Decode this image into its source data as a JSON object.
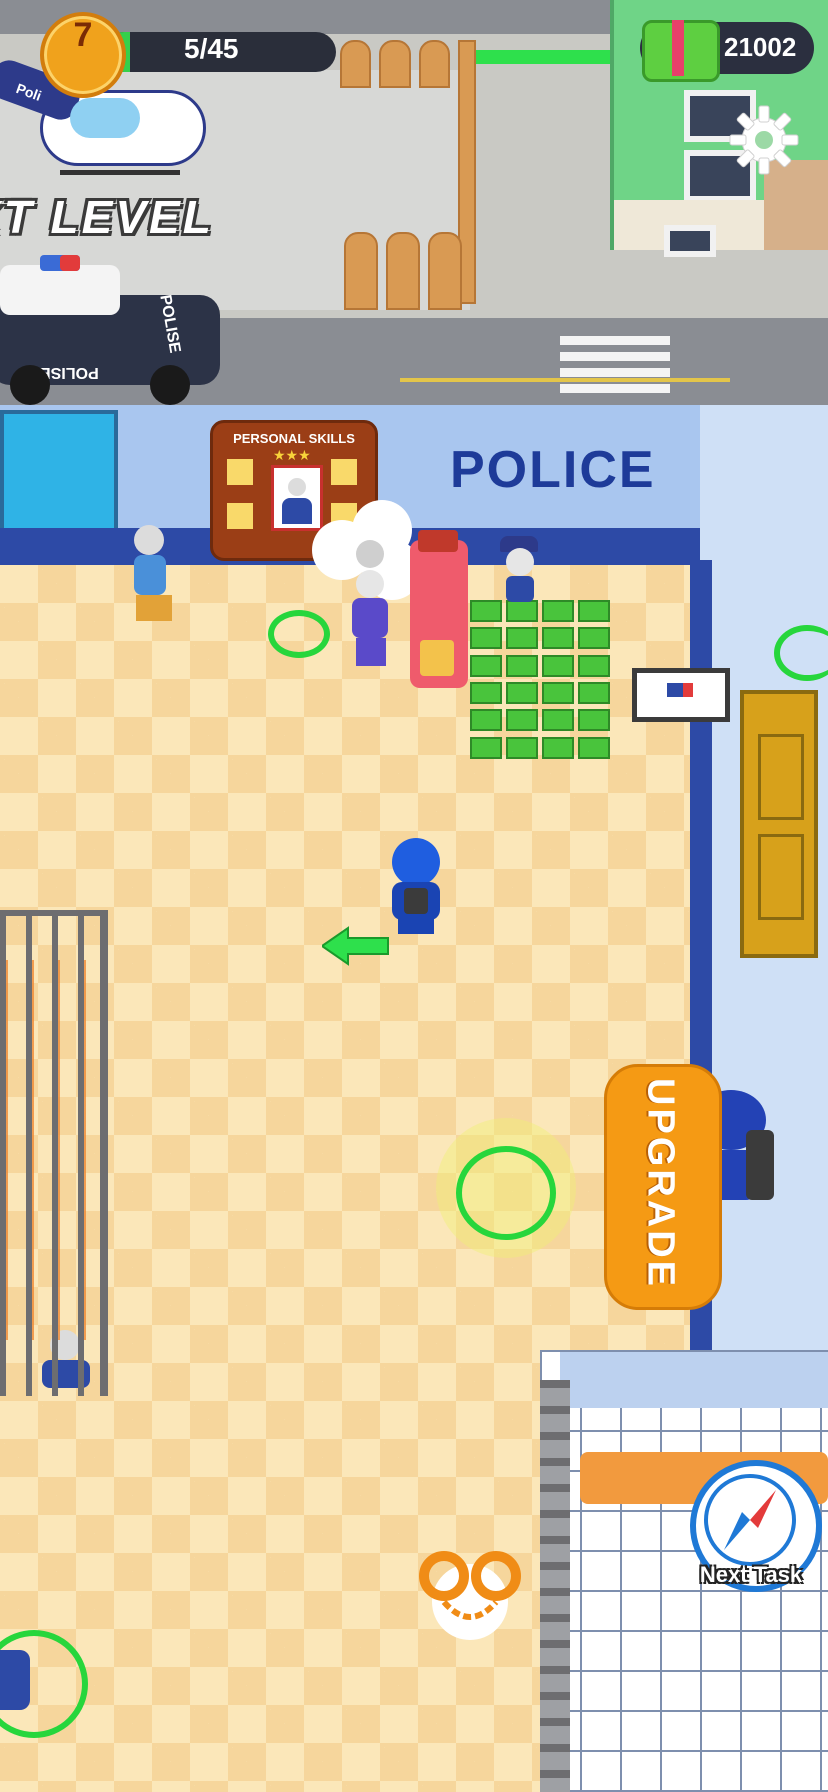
{
  "hud": {
    "level": "7",
    "progress_text": "5/45",
    "progress_fraction": 0.11,
    "money": "21002"
  },
  "scene": {
    "next_level_text": "XT LEVEL",
    "police_sign": "POLICE",
    "car_text_front": "POLISE",
    "car_text_side": "POLISE",
    "helicopter_text": "Poli",
    "skills_board_label": "PERSONAL SKILLS",
    "upgrade_label": "UPGRADE"
  },
  "buttons": {
    "next_task_label": "Next Task"
  },
  "icons": {
    "level": "police-badge-icon",
    "money": "cash-stack-icon",
    "settings": "gear-icon",
    "next_task": "compass-icon",
    "handcuffs": "handcuffs-icon",
    "move_arrow": "arrow-left-icon"
  },
  "colors": {
    "progress_fill": "#35d04b",
    "badge": "#f0a21c",
    "upgrade": "#f59a14",
    "police_blue": "#1e3b99",
    "ring_green": "#27d63c"
  }
}
